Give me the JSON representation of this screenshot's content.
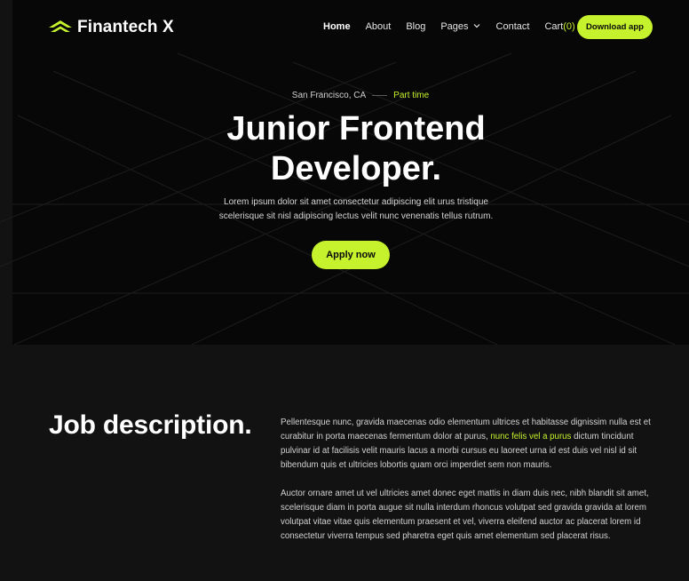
{
  "brand": {
    "name": "Finantech X",
    "logo_icon": "chevron-stack-logo-icon"
  },
  "nav": {
    "links": [
      "Home",
      "About",
      "Blog",
      "Pages",
      "Contact"
    ],
    "cart_label": "Cart",
    "cart_count": "(0)",
    "download_label": "Download app"
  },
  "hero": {
    "location": "San Francisco, CA",
    "job_type": "Part time",
    "title_line1": "Junior Frontend",
    "title_line2": "Developer.",
    "desc_line1": "Lorem ipsum dolor sit amet consectetur adipiscing elit urus tristique",
    "desc_line2": "scelerisque sit nisl adipiscing lectus velit nunc venenatis tellus rutrum.",
    "apply_label": "Apply now"
  },
  "job_description": {
    "heading": "Job description.",
    "p1_before": "Pellentesque nunc, gravida maecenas odio elementum ultrices et habitasse dignissim nulla est et curabitur in porta maecenas fermentum dolor at purus, ",
    "p1_highlight": "nunc felis vel a purus",
    "p1_after": " dictum tincidunt pulvinar id at facilisis velit mauris lacus a morbi cursus eu laoreet urna id est duis vel nisl id sit bibendum quis et ultricies lobortis quam orci imperdiet sem non mauris.",
    "p2": "Auctor ornare amet ut vel ultricies amet donec eget mattis in diam duis nec, nibh blandit sit amet, scelerisque diam in porta augue sit nulla interdum rhoncus volutpat sed gravida gravida at lorem volutpat vitae vitae quis elementum praesent et vel, viverra eleifend auctor ac placerat lorem id consectetur viverra tempus sed pharetra eget quis amet elementum sed placerat risus."
  },
  "colors": {
    "accent": "#c5f12d",
    "hero_bg": "#070707",
    "page_bg": "#121212"
  }
}
